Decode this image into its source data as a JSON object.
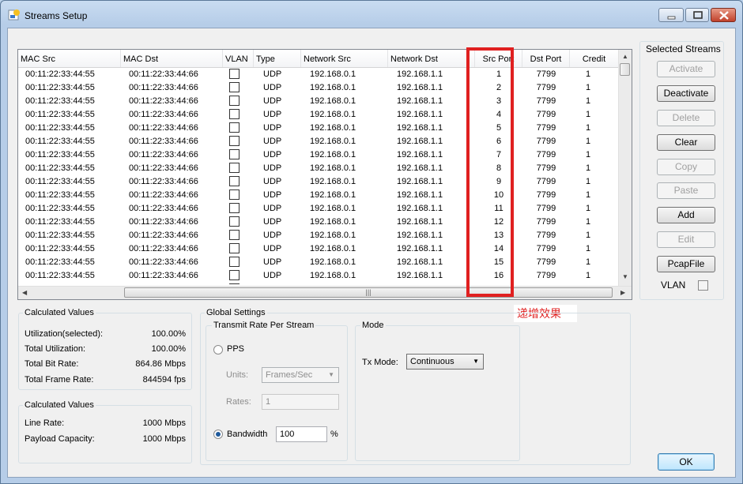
{
  "window": {
    "title": "Streams Setup",
    "min_label": "",
    "max_label": "",
    "close_label": ""
  },
  "table": {
    "columns": [
      "MAC Src",
      "MAC Dst",
      "VLAN",
      "Type",
      "Network Src",
      "Network Dst",
      "Src Port",
      "Dst Port",
      "Credit"
    ],
    "rows": [
      [
        "00:11:22:33:44:55",
        "00:11:22:33:44:66",
        "",
        "UDP",
        "192.168.0.1",
        "192.168.1.1",
        "1",
        "7799",
        "1"
      ],
      [
        "00:11:22:33:44:55",
        "00:11:22:33:44:66",
        "",
        "UDP",
        "192.168.0.1",
        "192.168.1.1",
        "2",
        "7799",
        "1"
      ],
      [
        "00:11:22:33:44:55",
        "00:11:22:33:44:66",
        "",
        "UDP",
        "192.168.0.1",
        "192.168.1.1",
        "3",
        "7799",
        "1"
      ],
      [
        "00:11:22:33:44:55",
        "00:11:22:33:44:66",
        "",
        "UDP",
        "192.168.0.1",
        "192.168.1.1",
        "4",
        "7799",
        "1"
      ],
      [
        "00:11:22:33:44:55",
        "00:11:22:33:44:66",
        "",
        "UDP",
        "192.168.0.1",
        "192.168.1.1",
        "5",
        "7799",
        "1"
      ],
      [
        "00:11:22:33:44:55",
        "00:11:22:33:44:66",
        "",
        "UDP",
        "192.168.0.1",
        "192.168.1.1",
        "6",
        "7799",
        "1"
      ],
      [
        "00:11:22:33:44:55",
        "00:11:22:33:44:66",
        "",
        "UDP",
        "192.168.0.1",
        "192.168.1.1",
        "7",
        "7799",
        "1"
      ],
      [
        "00:11:22:33:44:55",
        "00:11:22:33:44:66",
        "",
        "UDP",
        "192.168.0.1",
        "192.168.1.1",
        "8",
        "7799",
        "1"
      ],
      [
        "00:11:22:33:44:55",
        "00:11:22:33:44:66",
        "",
        "UDP",
        "192.168.0.1",
        "192.168.1.1",
        "9",
        "7799",
        "1"
      ],
      [
        "00:11:22:33:44:55",
        "00:11:22:33:44:66",
        "",
        "UDP",
        "192.168.0.1",
        "192.168.1.1",
        "10",
        "7799",
        "1"
      ],
      [
        "00:11:22:33:44:55",
        "00:11:22:33:44:66",
        "",
        "UDP",
        "192.168.0.1",
        "192.168.1.1",
        "11",
        "7799",
        "1"
      ],
      [
        "00:11:22:33:44:55",
        "00:11:22:33:44:66",
        "",
        "UDP",
        "192.168.0.1",
        "192.168.1.1",
        "12",
        "7799",
        "1"
      ],
      [
        "00:11:22:33:44:55",
        "00:11:22:33:44:66",
        "",
        "UDP",
        "192.168.0.1",
        "192.168.1.1",
        "13",
        "7799",
        "1"
      ],
      [
        "00:11:22:33:44:55",
        "00:11:22:33:44:66",
        "",
        "UDP",
        "192.168.0.1",
        "192.168.1.1",
        "14",
        "7799",
        "1"
      ],
      [
        "00:11:22:33:44:55",
        "00:11:22:33:44:66",
        "",
        "UDP",
        "192.168.0.1",
        "192.168.1.1",
        "15",
        "7799",
        "1"
      ],
      [
        "00:11:22:33:44:55",
        "00:11:22:33:44:66",
        "",
        "UDP",
        "192.168.0.1",
        "192.168.1.1",
        "16",
        "7799",
        "1"
      ]
    ]
  },
  "annotation": {
    "text": "递增效果",
    "color": "#e02020"
  },
  "selected_streams": {
    "title": "Selected Streams",
    "activate": "Activate",
    "deactivate": "Deactivate",
    "delete": "Delete",
    "clear": "Clear",
    "copy": "Copy",
    "paste": "Paste",
    "add": "Add",
    "edit": "Edit",
    "pcapfile": "PcapFile",
    "vlan_label": "VLAN"
  },
  "calculated_values_1": {
    "title": "Calculated Values",
    "utilization_selected_label": "Utilization(selected):",
    "utilization_selected_value": "100.00%",
    "total_utilization_label": "Total Utilization:",
    "total_utilization_value": "100.00%",
    "total_bit_rate_label": "Total Bit Rate:",
    "total_bit_rate_value": "864.86 Mbps",
    "total_frame_rate_label": "Total Frame Rate:",
    "total_frame_rate_value": "844594 fps"
  },
  "calculated_values_2": {
    "title": "Calculated Values",
    "line_rate_label": "Line Rate:",
    "line_rate_value": "1000 Mbps",
    "payload_capacity_label": "Payload Capacity:",
    "payload_capacity_value": "1000 Mbps"
  },
  "global_settings": {
    "title": "Global Settings",
    "transmit_title": "Transmit Rate Per Stream",
    "pps_label": "PPS",
    "units_label": "Units:",
    "units_value": "Frames/Sec",
    "rates_label": "Rates:",
    "rates_value": "1",
    "bandwidth_label": "Bandwidth",
    "bandwidth_value": "100",
    "percent": "%"
  },
  "mode": {
    "title": "Mode",
    "tx_mode_label": "Tx Mode:",
    "tx_mode_value": "Continuous"
  },
  "ok_label": "OK",
  "colors": {
    "highlight": "#e02020",
    "accent": "#1f5a9c"
  }
}
